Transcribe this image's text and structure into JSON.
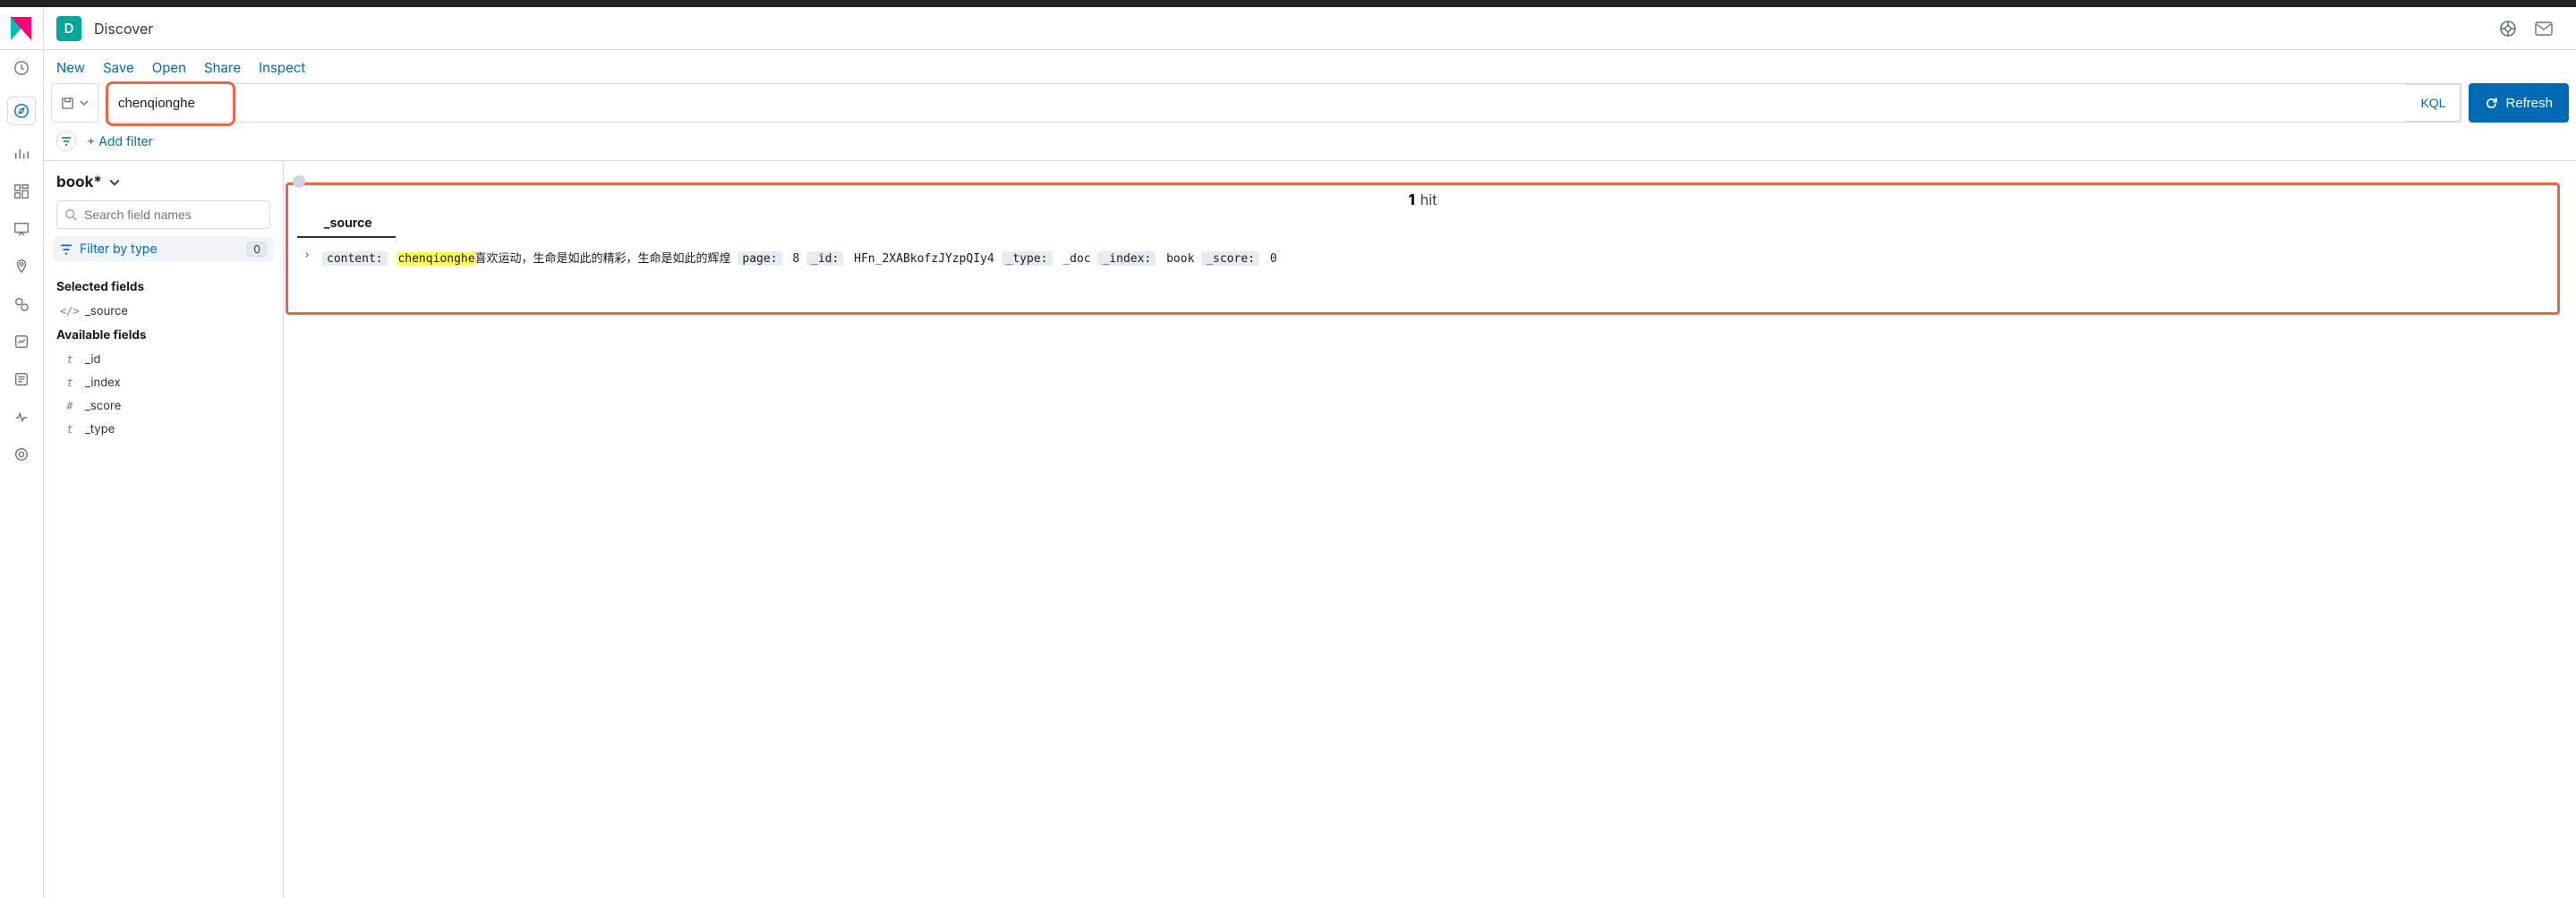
{
  "header": {
    "app_badge": "D",
    "breadcrumb": "Discover"
  },
  "menu": {
    "new": "New",
    "save": "Save",
    "open": "Open",
    "share": "Share",
    "inspect": "Inspect"
  },
  "query": {
    "value": "chenqionghe",
    "placeholder": "Search",
    "kql": "KQL",
    "refresh": "Refresh"
  },
  "filter": {
    "add": "+ Add filter"
  },
  "sidebar": {
    "index_pattern": "book*",
    "search_placeholder": "Search field names",
    "filter_by_type": "Filter by type",
    "filter_type_count": "0",
    "selected_heading": "Selected fields",
    "selected": [
      {
        "glyph": "</>",
        "name": "_source"
      }
    ],
    "available_heading": "Available fields",
    "available": [
      {
        "glyph": "t",
        "name": "_id"
      },
      {
        "glyph": "t",
        "name": "_index"
      },
      {
        "glyph": "#",
        "name": "_score"
      },
      {
        "glyph": "t",
        "name": "_type"
      }
    ]
  },
  "results": {
    "hit_count_num": "1",
    "hit_count_label": "hit",
    "column": "_source",
    "doc": {
      "content_key": "content:",
      "content_hl": "chenqionghe",
      "content_rest": "喜欢运动，生命是如此的精彩，生命是如此的辉煌",
      "page_key": "page:",
      "page_val": "8",
      "id_key": "_id:",
      "id_val": "HFn_2XABkofzJYzpQIy4",
      "type_key": "_type:",
      "type_val": "_doc",
      "index_key": "_index:",
      "index_val": "book",
      "score_key": "_score:",
      "score_val": "0"
    }
  }
}
